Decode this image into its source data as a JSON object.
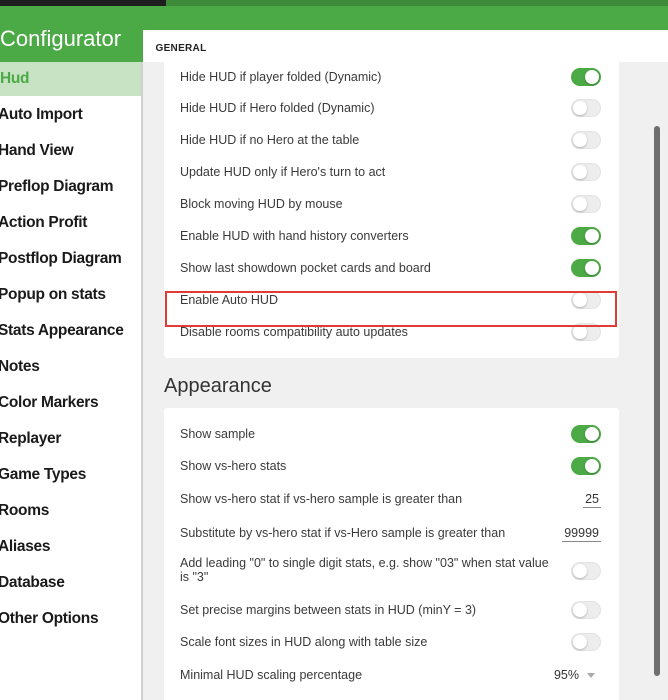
{
  "app": {
    "title": "Configurator"
  },
  "tabs": [
    {
      "label": "GENERAL"
    }
  ],
  "sidebar": {
    "items": [
      {
        "label": "Hud",
        "active": true
      },
      {
        "label": "Auto Import"
      },
      {
        "label": "Hand View"
      },
      {
        "label": "Preflop Diagram"
      },
      {
        "label": "Action Profit"
      },
      {
        "label": "Postflop Diagram"
      },
      {
        "label": "Popup on stats"
      },
      {
        "label": "Stats Appearance"
      },
      {
        "label": "Notes"
      },
      {
        "label": "Color Markers"
      },
      {
        "label": "Replayer"
      },
      {
        "label": "Game Types"
      },
      {
        "label": "Rooms"
      },
      {
        "label": "Aliases"
      },
      {
        "label": "Database"
      },
      {
        "label": "Other Options"
      }
    ]
  },
  "general": {
    "settings": [
      {
        "label": "Hide HUD if player folded (Dynamic)",
        "on": true
      },
      {
        "label": "Hide HUD if Hero folded (Dynamic)",
        "on": false
      },
      {
        "label": "Hide HUD if no Hero at the table",
        "on": false
      },
      {
        "label": "Update HUD only if Hero's turn to act",
        "on": false
      },
      {
        "label": "Block moving HUD by mouse",
        "on": false
      },
      {
        "label": "Enable HUD with hand history converters",
        "on": true
      },
      {
        "label": "Show last showdown pocket cards and board",
        "on": true
      },
      {
        "label": "Enable Auto HUD",
        "on": false,
        "highlighted": true
      },
      {
        "label": "Disable rooms compatibility auto updates",
        "on": false
      }
    ]
  },
  "appearance": {
    "title": "Appearance",
    "settings": [
      {
        "label": "Show sample",
        "on": true
      },
      {
        "label": "Show vs-hero stats",
        "on": true
      },
      {
        "label": "Show vs-hero stat if vs-hero sample is greater than",
        "value": "25"
      },
      {
        "label": "Substitute by vs-hero stat if vs-Hero sample is greater than",
        "value": "99999"
      },
      {
        "label": "Add leading \"0\" to single digit stats, e.g. show \"03\" when stat value is \"3\"",
        "on": false
      },
      {
        "label": "Set precise margins between stats in HUD (minY = 3)",
        "on": false
      },
      {
        "label": "Scale font sizes in HUD along with table size",
        "on": false
      },
      {
        "label": "Minimal HUD scaling percentage",
        "value": "95%"
      }
    ]
  },
  "colors": {
    "accent": "#4caa46",
    "highlight": "#e23b35"
  }
}
